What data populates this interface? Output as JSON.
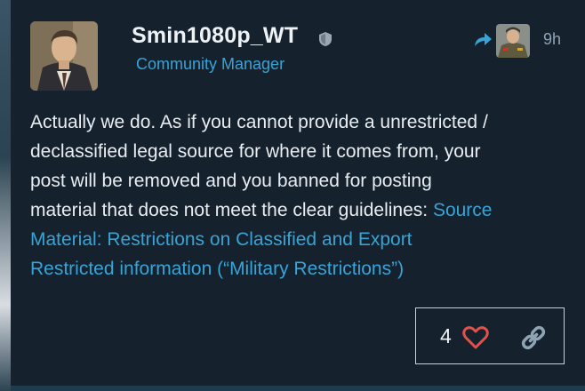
{
  "post": {
    "username": "Smin1080p_WT",
    "role": "Community Manager",
    "time": "9h",
    "body_lines": [
      "Actually we do. As if you cannot provide a unrestricted /",
      "declassified legal source for where it comes from, your",
      "post will be removed and you banned for posting",
      "material that does not meet the clear guidelines: "
    ],
    "link_lines": [
      "Source",
      "Material: Restrictions on Classified and Export",
      "Restricted information (“Military Restrictions”)"
    ],
    "like_count": "4"
  },
  "icons": {
    "badge": "shield-icon",
    "reply": "reply-arrow-icon",
    "like": "heart-icon",
    "share": "link-icon"
  },
  "colors": {
    "background": "#15222e",
    "accent": "#38a3d6",
    "text": "#e8edf1",
    "heart": "#e0524a"
  }
}
